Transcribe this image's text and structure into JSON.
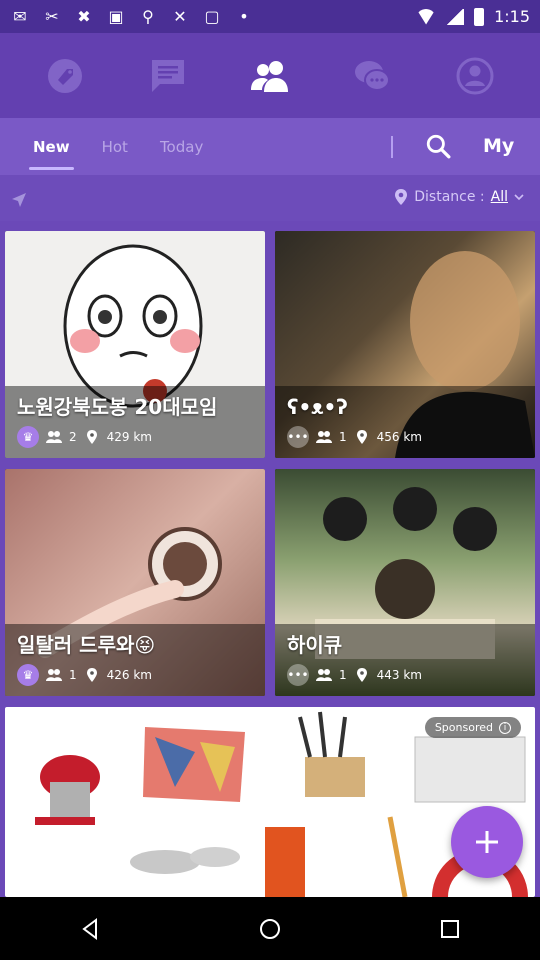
{
  "status_bar": {
    "time": "1:15"
  },
  "top_tabs": [
    {
      "icon": "tag-icon"
    },
    {
      "icon": "message-icon"
    },
    {
      "icon": "group-icon",
      "active": true
    },
    {
      "icon": "chat-bubbles-icon"
    },
    {
      "icon": "profile-icon"
    }
  ],
  "sub_tabs": {
    "items": [
      {
        "label": "New",
        "active": true
      },
      {
        "label": "Hot",
        "active": false
      },
      {
        "label": "Today",
        "active": false
      }
    ],
    "my_label": "My"
  },
  "distance": {
    "label": "Distance :",
    "value": "All"
  },
  "cards": [
    {
      "title": "노원강북도봉 20대모임",
      "members": "2",
      "distance": "429 km",
      "badge": "purple"
    },
    {
      "title": "ʕ•ᴥ•ʔ",
      "members": "1",
      "distance": "456 km",
      "badge": "gray"
    },
    {
      "title": "일탈러 드루와😝",
      "members": "1",
      "distance": "426 km",
      "badge": "purple"
    },
    {
      "title": "하이큐",
      "members": "1",
      "distance": "443 km",
      "badge": "gray"
    }
  ],
  "ad": {
    "sponsored_label": "Sponsored"
  },
  "colors": {
    "accent": "#6b49b8",
    "fab": "#9a59e0"
  }
}
